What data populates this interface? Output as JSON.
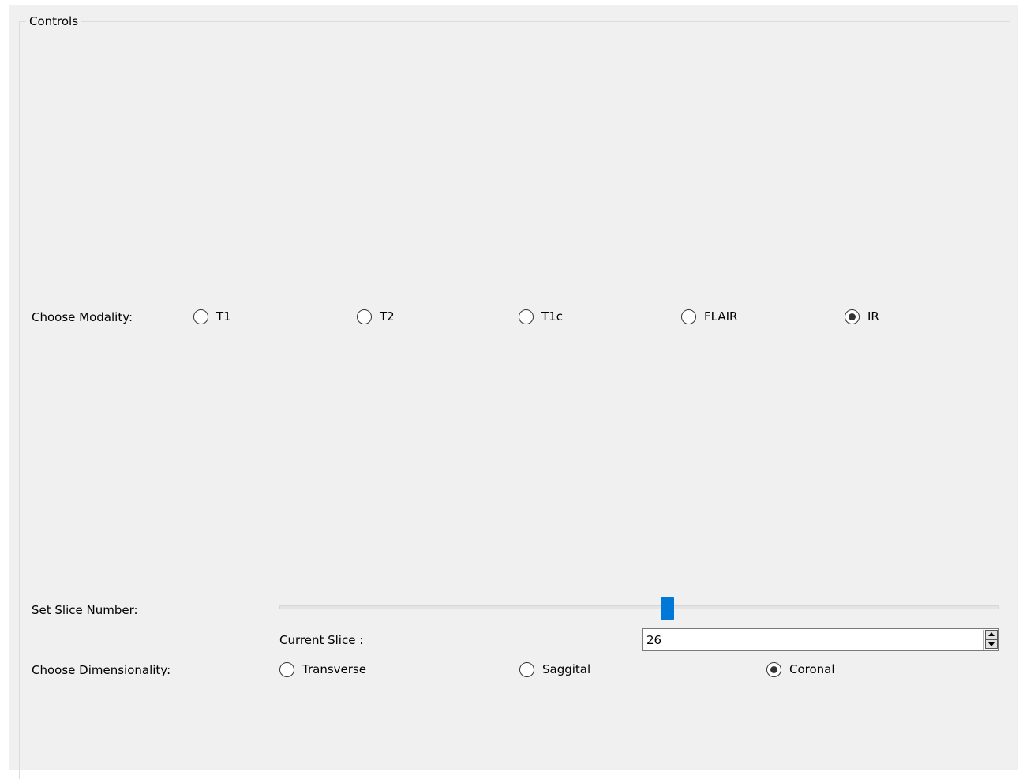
{
  "group": {
    "title": "Controls"
  },
  "modality": {
    "label": "Choose Modality:",
    "options": [
      "T1",
      "T2",
      "T1c",
      "FLAIR",
      "IR"
    ],
    "selected": "IR"
  },
  "slice": {
    "label": "Set Slice Number:",
    "current_label": "Current Slice :",
    "value": "26",
    "slider_fraction": 0.54
  },
  "dimensionality": {
    "label": "Choose Dimensionality:",
    "options": [
      "Transverse",
      "Saggital",
      "Coronal"
    ],
    "selected": "Coronal"
  },
  "colors": {
    "accent": "#0078d7",
    "background": "#f0f0f0"
  }
}
